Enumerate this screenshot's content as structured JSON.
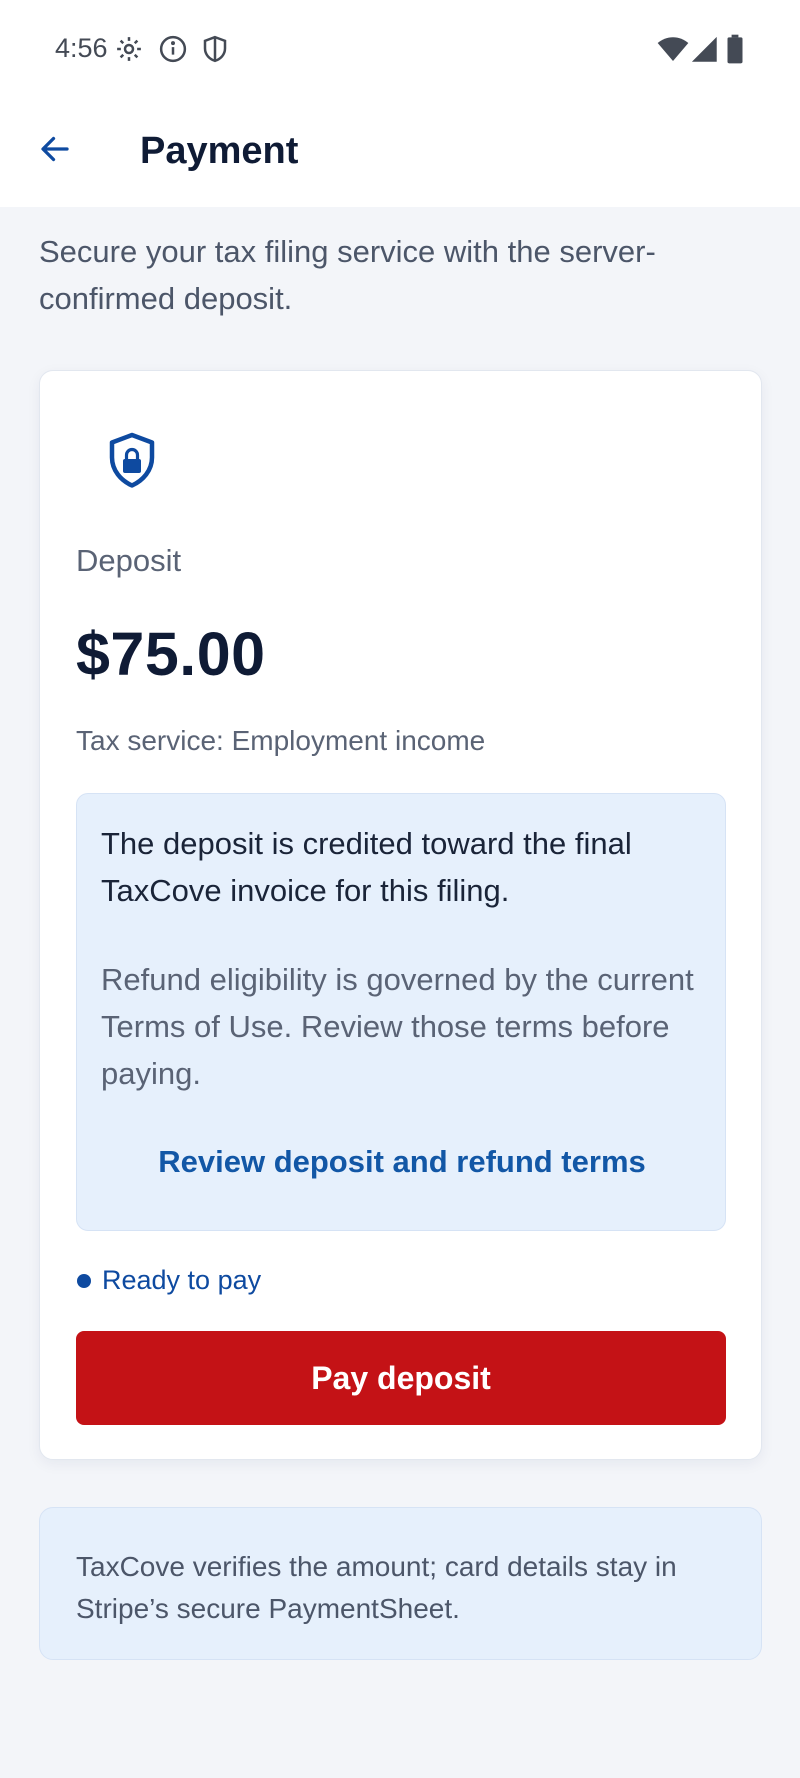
{
  "status_bar": {
    "time": "4:56",
    "left_icons": [
      "gear-icon",
      "info-icon",
      "shield-icon"
    ],
    "right_icons": [
      "wifi-icon",
      "signal-icon",
      "battery-icon"
    ]
  },
  "app_bar": {
    "back_icon": "arrow-left-icon",
    "title": "Payment"
  },
  "intro": "Secure your tax filing service with the server-confirmed deposit.",
  "card": {
    "icon": "shield-lock-icon",
    "deposit_label": "Deposit",
    "amount": "$75.00",
    "service": "Tax service: Employment income",
    "info_primary": "The deposit is credited toward the final TaxCove invoice for this filing.",
    "info_secondary": "Refund eligibility is governed by the current Terms of Use. Review those terms before paying.",
    "terms_link": "Review deposit and refund terms",
    "status": "Ready to pay",
    "pay_button": "Pay deposit"
  },
  "note": "TaxCove verifies the amount; card details stay in Stripe’s secure PaymentSheet.",
  "colors": {
    "accent_blue": "#0e4aa0",
    "link_blue": "#1257a6",
    "pay_red": "#c41216",
    "info_bg": "#e6f0fc",
    "page_bg": "#f3f5f9"
  }
}
